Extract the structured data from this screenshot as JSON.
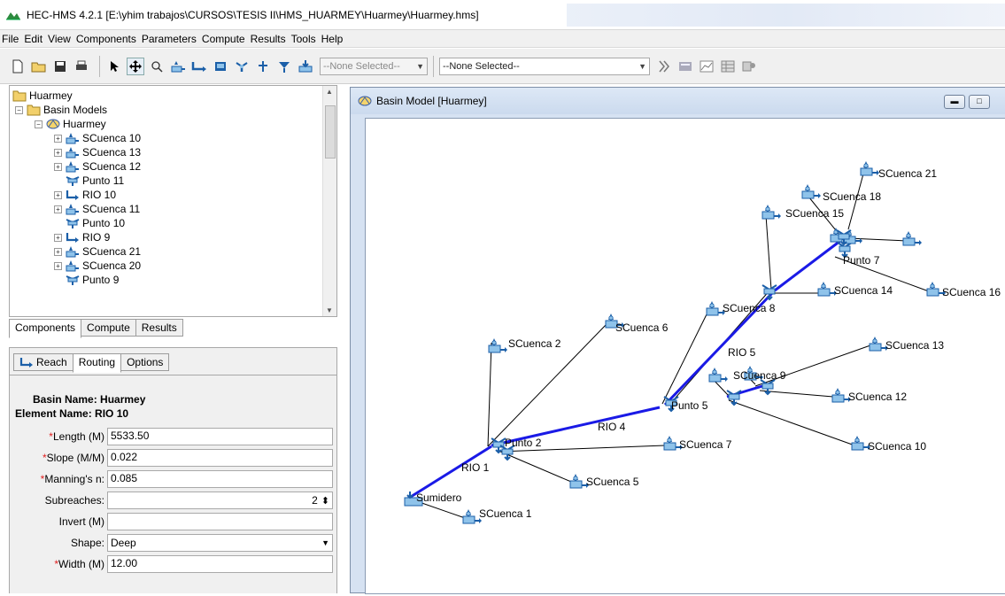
{
  "window": {
    "title": "HEC-HMS 4.2.1 [E:\\yhim trabajos\\CURSOS\\TESIS II\\HMS_HUARMEY\\Huarmey\\Huarmey.hms]"
  },
  "menu": [
    "File",
    "Edit",
    "View",
    "Components",
    "Parameters",
    "Compute",
    "Results",
    "Tools",
    "Help"
  ],
  "toolbar": {
    "combo1": "--None Selected--",
    "combo2": "--None Selected--"
  },
  "tree": {
    "root": "Huarmey",
    "basin_models": "Basin Models",
    "model": "Huarmey",
    "items": [
      "SCuenca 10",
      "SCuenca 13",
      "SCuenca 12",
      "Punto 11",
      "RIO 10",
      "SCuenca 11",
      "Punto 10",
      "RIO 9",
      "SCuenca 21",
      "SCuenca 20",
      "Punto 9"
    ]
  },
  "bottom_tabs": [
    "Components",
    "Compute",
    "Results"
  ],
  "prop_tabs": [
    "Reach",
    "Routing",
    "Options"
  ],
  "props": {
    "basin_name": "Basin Name: Huarmey",
    "element_name": "Element Name: RIO 10",
    "fields": [
      {
        "label": "Length (M)",
        "required": true,
        "value": "5533.50"
      },
      {
        "label": "Slope (M/M)",
        "required": true,
        "value": "0.022"
      },
      {
        "label": "Manning's n:",
        "required": true,
        "value": "0.085"
      },
      {
        "label": "Subreaches:",
        "required": false,
        "value": "2"
      },
      {
        "label": "Invert (M)",
        "required": false,
        "value": ""
      },
      {
        "label": "Shape:",
        "required": false,
        "value": "Deep"
      },
      {
        "label": "Width (M)",
        "required": true,
        "value": "12.00"
      }
    ]
  },
  "basin_window": {
    "title": "Basin Model [Huarmey]"
  },
  "map_labels": {
    "sumidero": "Sumidero",
    "sc1": "SCuenca 1",
    "sc2": "SCuenca 2",
    "sc5": "SCuenca 5",
    "sc6": "SCuenca 6",
    "sc7": "SCuenca 7",
    "sc8": "SCuenca 8",
    "sc9": "SCuenca 9",
    "sc10": "SCuenca 10",
    "sc12": "SCuenca 12",
    "sc13": "SCuenca 13",
    "sc14": "SCuenca 14",
    "sc15": "SCuenca 15",
    "sc16": "SCuenca 16",
    "sc18": "SCuenca 18",
    "sc21": "SCuenca 21",
    "punto2": "Punto 2",
    "punto5": "Punto 5",
    "punto7": "Punto 7",
    "rio1": "RIO 1",
    "rio4": "RIO 4",
    "rio5": "RIO 5"
  },
  "colors": {
    "reach": "#1a1ae6",
    "link": "#000000",
    "accent_required": "#e02020"
  }
}
